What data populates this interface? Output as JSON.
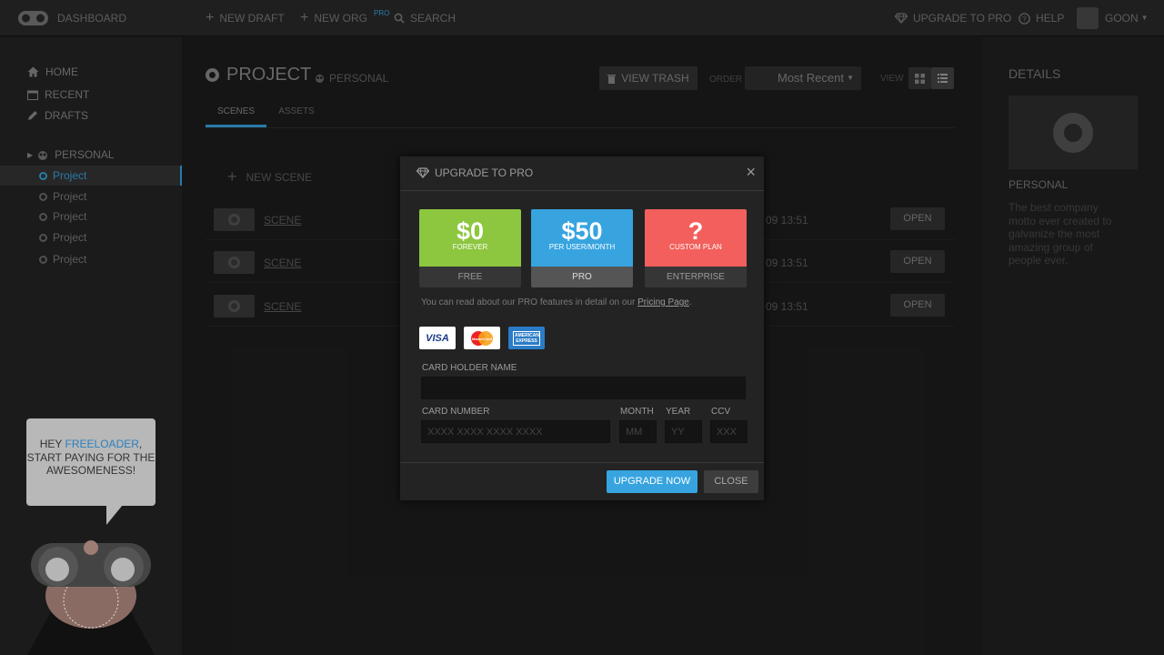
{
  "topbar": {
    "logo_label": "DASHBOARD",
    "new_draft": "NEW DRAFT",
    "new_org": "NEW ORG",
    "new_org_badge": "PRO",
    "search": "SEARCH",
    "upgrade": "UPGRADE TO PRO",
    "help": "HELP",
    "user": "GOON"
  },
  "sidebar": {
    "nav": [
      {
        "label": "HOME",
        "icon": "home-icon"
      },
      {
        "label": "RECENT",
        "icon": "calendar-icon"
      },
      {
        "label": "DRAFTS",
        "icon": "pencil-icon"
      }
    ],
    "group_label": "PERSONAL",
    "projects": [
      {
        "label": "Project",
        "active": true
      },
      {
        "label": "Project",
        "active": false
      },
      {
        "label": "Project",
        "active": false
      },
      {
        "label": "Project",
        "active": false
      },
      {
        "label": "Project",
        "active": false
      }
    ],
    "bubble": {
      "prefix": "HEY ",
      "highlight": "FREELOADER",
      "suffix": ", START PAYING FOR THE AWESOMENESS!"
    }
  },
  "main": {
    "title": "PROJECT",
    "owner": "PERSONAL",
    "tabs": [
      "SCENES",
      "ASSETS"
    ],
    "view_trash": "VIEW TRASH",
    "order_label": "ORDER",
    "order_value": "Most Recent",
    "view_label": "VIEW",
    "new_scene": "NEW SCENE",
    "scenes": [
      {
        "name": "SCENE",
        "date": "09 13:51",
        "action": "OPEN"
      },
      {
        "name": "SCENE",
        "date": "09 13:51",
        "action": "OPEN"
      },
      {
        "name": "SCENE",
        "date": "09 13:51",
        "action": "OPEN"
      }
    ]
  },
  "details": {
    "heading": "DETAILS",
    "name": "PERSONAL",
    "description": "The best company motto ever created to galvanize the most amazing group of people ever."
  },
  "modal": {
    "title": "UPGRADE TO PRO",
    "close_glyph": "×",
    "plans": [
      {
        "price": "$0",
        "sub": "FOREVER",
        "name": "FREE",
        "color": "#8dc63f",
        "selected": false
      },
      {
        "price": "$50",
        "sub": "PER USER/MONTH",
        "name": "PRO",
        "color": "#37a4e0",
        "selected": true
      },
      {
        "price": "?",
        "sub": "CUSTOM PLAN",
        "name": "ENTERPRISE",
        "color": "#f25f5c",
        "selected": false
      }
    ],
    "note_prefix": "You can read about our PRO features in detail on our ",
    "note_link": "Pricing Page",
    "note_suffix": ".",
    "cards": [
      "VISA",
      "MasterCard",
      "AMERICAN EXPRESS"
    ],
    "card_holder_label": "CARD HOLDER NAME",
    "card_holder_value": "",
    "card_number_label": "CARD NUMBER",
    "card_number_placeholder": "XXXX XXXX XXXX XXXX",
    "month_label": "MONTH",
    "month_placeholder": "MM",
    "year_label": "YEAR",
    "year_placeholder": "YY",
    "ccv_label": "CCV",
    "ccv_placeholder": "XXX",
    "upgrade_button": "UPGRADE NOW",
    "close_button": "CLOSE"
  }
}
